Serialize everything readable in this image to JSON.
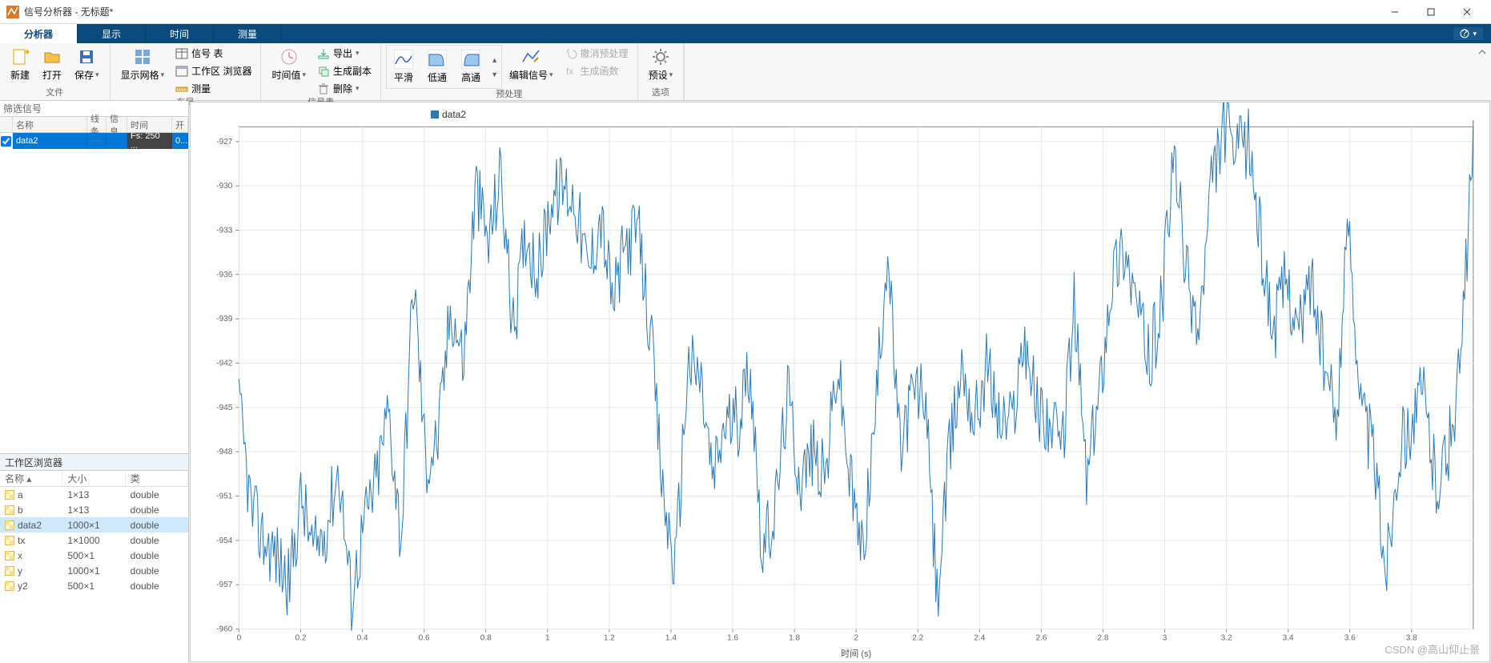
{
  "window": {
    "title": "信号分析器 - 无标题*"
  },
  "tabs": {
    "t1": "分析器",
    "t2": "显示",
    "t3": "时间",
    "t4": "测量"
  },
  "ribbon": {
    "g_file": "文件",
    "new": "新建",
    "open": "打开",
    "save": "保存",
    "g_layout": "布局",
    "grid": "显示网格",
    "sigtable": "信号 表",
    "wsbrowser": "工作区 浏览器",
    "measure": "测量",
    "g_sigtable": "信号表",
    "timeval": "时间值",
    "export": "导出",
    "gencopy": "生成副本",
    "delete": "删除",
    "g_pre": "预处理",
    "smooth": "平滑",
    "lowpass": "低通",
    "highpass": "高通",
    "editsig": "编辑信号",
    "undo": "撤消预处理",
    "genfunc": "生成函数",
    "g_opt": "选项",
    "preset": "预设"
  },
  "filter": {
    "placeholder": "筛选信号"
  },
  "sigtable": {
    "h_name": "名称",
    "h_line": "线条",
    "h_info": "信息",
    "h_time": "时间",
    "h_open": "开",
    "row0_name": "data2",
    "row0_time": "Fs: 250 ...",
    "row0_open": "0..."
  },
  "workspace": {
    "title": "工作区浏览器",
    "h_name": "名称 ▴",
    "h_size": "大小",
    "h_class": "类",
    "rows": [
      {
        "n": "a",
        "s": "1×13",
        "c": "double",
        "sel": false
      },
      {
        "n": "b",
        "s": "1×13",
        "c": "double",
        "sel": false
      },
      {
        "n": "data2",
        "s": "1000×1",
        "c": "double",
        "sel": true
      },
      {
        "n": "tx",
        "s": "1×1000",
        "c": "double",
        "sel": false
      },
      {
        "n": "x",
        "s": "500×1",
        "c": "double",
        "sel": false
      },
      {
        "n": "y",
        "s": "1000×1",
        "c": "double",
        "sel": false
      },
      {
        "n": "y2",
        "s": "500×1",
        "c": "double",
        "sel": false
      }
    ]
  },
  "chart": {
    "legend": "data2",
    "xlabel": "时间 (s)"
  },
  "watermark": "CSDN @高山仰止景",
  "chart_data": {
    "type": "line",
    "title": "",
    "xlabel": "时间 (s)",
    "ylabel": "",
    "xlim": [
      0,
      4.0
    ],
    "ylim": [
      -960,
      -926
    ],
    "xticks": [
      0,
      0.2,
      0.4,
      0.6,
      0.8,
      1.0,
      1.2,
      1.4,
      1.6,
      1.8,
      2.0,
      2.2,
      2.4,
      2.6,
      2.8,
      3.0,
      3.2,
      3.4,
      3.6,
      3.8
    ],
    "yticks": [
      -960,
      -957,
      -954,
      -951,
      -948,
      -945,
      -942,
      -939,
      -936,
      -933,
      -930,
      -927
    ],
    "grid": true,
    "legend": [
      "data2"
    ],
    "series": [
      {
        "name": "data2",
        "x_note": "x runs 0..3.996 at 0.004s step (1000 points). Values approximated from plot.",
        "values_sampled_every_0_04s": [
          -945,
          -952,
          -954,
          -955,
          -957,
          -951,
          -955,
          -953,
          -949,
          -958,
          -953,
          -950,
          -945,
          -954,
          -936,
          -949,
          -947,
          -938,
          -942,
          -930,
          -934,
          -929,
          -940,
          -933,
          -936,
          -931,
          -930,
          -931,
          -936,
          -932,
          -938,
          -934,
          -933,
          -940,
          -951,
          -956,
          -942,
          -943,
          -950,
          -946,
          -946,
          -942,
          -955,
          -952,
          -944,
          -950,
          -948,
          -950,
          -942,
          -950,
          -955,
          -946,
          -934,
          -948,
          -944,
          -944,
          -958,
          -948,
          -942,
          -946,
          -942,
          -946,
          -946,
          -940,
          -945,
          -946,
          -948,
          -938,
          -950,
          -944,
          -936,
          -934,
          -938,
          -942,
          -938,
          -928,
          -936,
          -940,
          -930,
          -926,
          -928,
          -927,
          -934,
          -940,
          -936,
          -940,
          -936,
          -942,
          -946,
          -932,
          -945,
          -948,
          -956,
          -948,
          -946,
          -944,
          -950,
          -948,
          -942,
          -927
        ]
      }
    ]
  }
}
